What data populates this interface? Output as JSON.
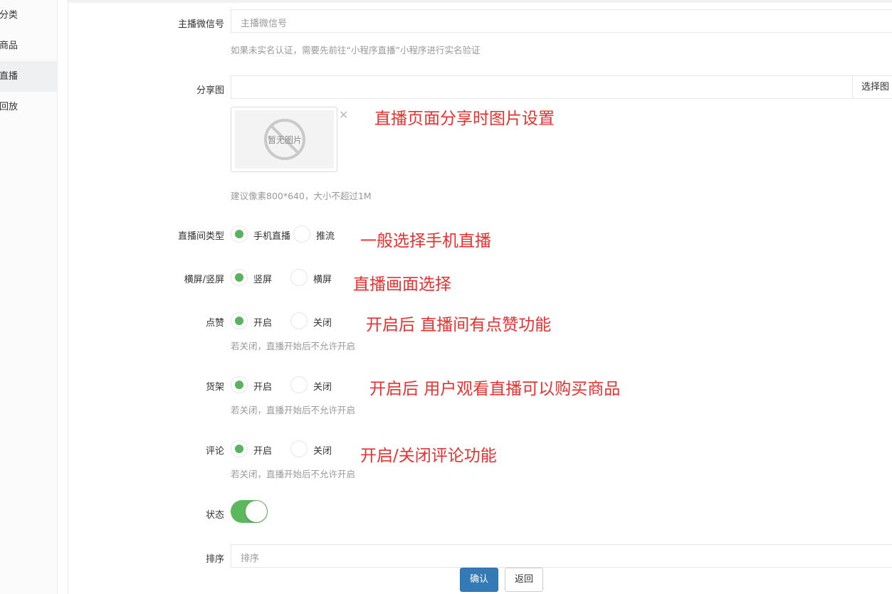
{
  "sidebar": {
    "items": [
      {
        "label": "分类",
        "active": false
      },
      {
        "label": "商品",
        "active": false
      },
      {
        "label": "直播",
        "active": true
      },
      {
        "label": "回放",
        "active": false
      }
    ]
  },
  "form": {
    "wechat": {
      "label": "主播微信号",
      "placeholder": "主播微信号",
      "help": "如果未实名认证，需要先前往“小程序直播”小程序进行实名验证"
    },
    "share_image": {
      "label": "分享图",
      "select_button": "选择图",
      "no_image_text": "暂无图片",
      "help": "建议像素800*640，大小不超过1M"
    },
    "room_type": {
      "label": "直播间类型",
      "options": [
        "手机直播",
        "推流"
      ],
      "selected": "手机直播"
    },
    "orientation": {
      "label": "横屏/竖屏",
      "options": [
        "竖屏",
        "横屏"
      ],
      "selected": "竖屏"
    },
    "like": {
      "label": "点赞",
      "options": [
        "开启",
        "关闭"
      ],
      "selected": "开启",
      "help": "若关闭，直播开始后不允许开启"
    },
    "shelf": {
      "label": "货架",
      "options": [
        "开启",
        "关闭"
      ],
      "selected": "开启",
      "help": "若关闭，直播开始后不允许开启"
    },
    "comment": {
      "label": "评论",
      "options": [
        "开启",
        "关闭"
      ],
      "selected": "开启",
      "help": "若关闭，直播开始后不允许开启"
    },
    "status": {
      "label": "状态",
      "on": true
    },
    "sort": {
      "label": "排序",
      "placeholder": "排序"
    }
  },
  "annotations": {
    "share": "直播页面分享时图片设置",
    "room_type": "一般选择手机直播",
    "orientation": "直播画面选择",
    "like": "开启后 直播间有点赞功能",
    "shelf": "开启后 用户观看直播可以购买商品",
    "comment": "开启/关闭评论功能"
  },
  "actions": {
    "confirm": "确认",
    "back": "返回"
  },
  "colors": {
    "accent_green": "#5cb85c",
    "primary_blue": "#337ab7",
    "annotation_red": "#e8312f"
  }
}
